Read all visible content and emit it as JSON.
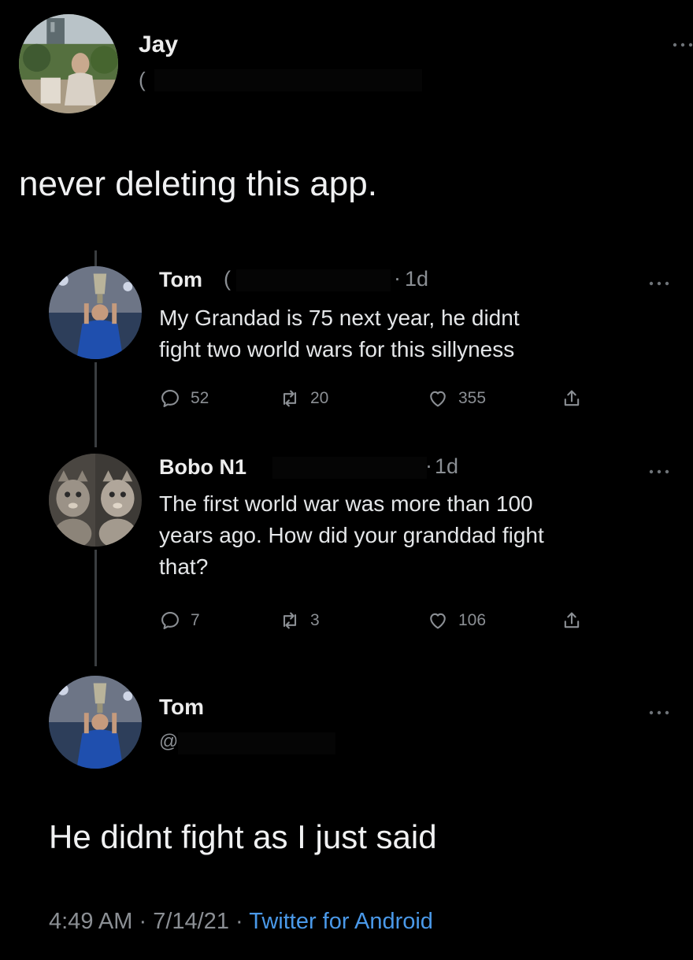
{
  "main_tweet": {
    "author_name": "Jay",
    "handle_fragment": "(",
    "text": "never deleting this app."
  },
  "replies": [
    {
      "author_name": "Tom",
      "handle_fragment": "(",
      "time": "1d",
      "text_lines": [
        "My Grandad is 75 next year,  he didnt",
        "fight two world wars for this sillyness"
      ],
      "reply_count": "52",
      "retweet_count": "20",
      "like_count": "355"
    },
    {
      "author_name": "Bobo N1",
      "time": "1d",
      "text_lines": [
        "The first world war was more than 100",
        "years ago. How did your granddad fight",
        "that?"
      ],
      "reply_count": "7",
      "retweet_count": "3",
      "like_count": "106"
    }
  ],
  "focused_tweet": {
    "author_name": "Tom",
    "handle_fragment": "@",
    "text": "He didnt fight as I just said",
    "time": "4:49 AM",
    "date": "7/14/21",
    "source": "Twitter for Android"
  },
  "icons": {
    "more": "more-horizontal-icon",
    "reply": "reply-icon",
    "retweet": "retweet-icon",
    "like": "heart-icon",
    "share": "share-icon"
  },
  "colors": {
    "background": "#000000",
    "text_primary": "#e7e9ea",
    "text_secondary": "#8b8f94",
    "link": "#4a99e9"
  }
}
